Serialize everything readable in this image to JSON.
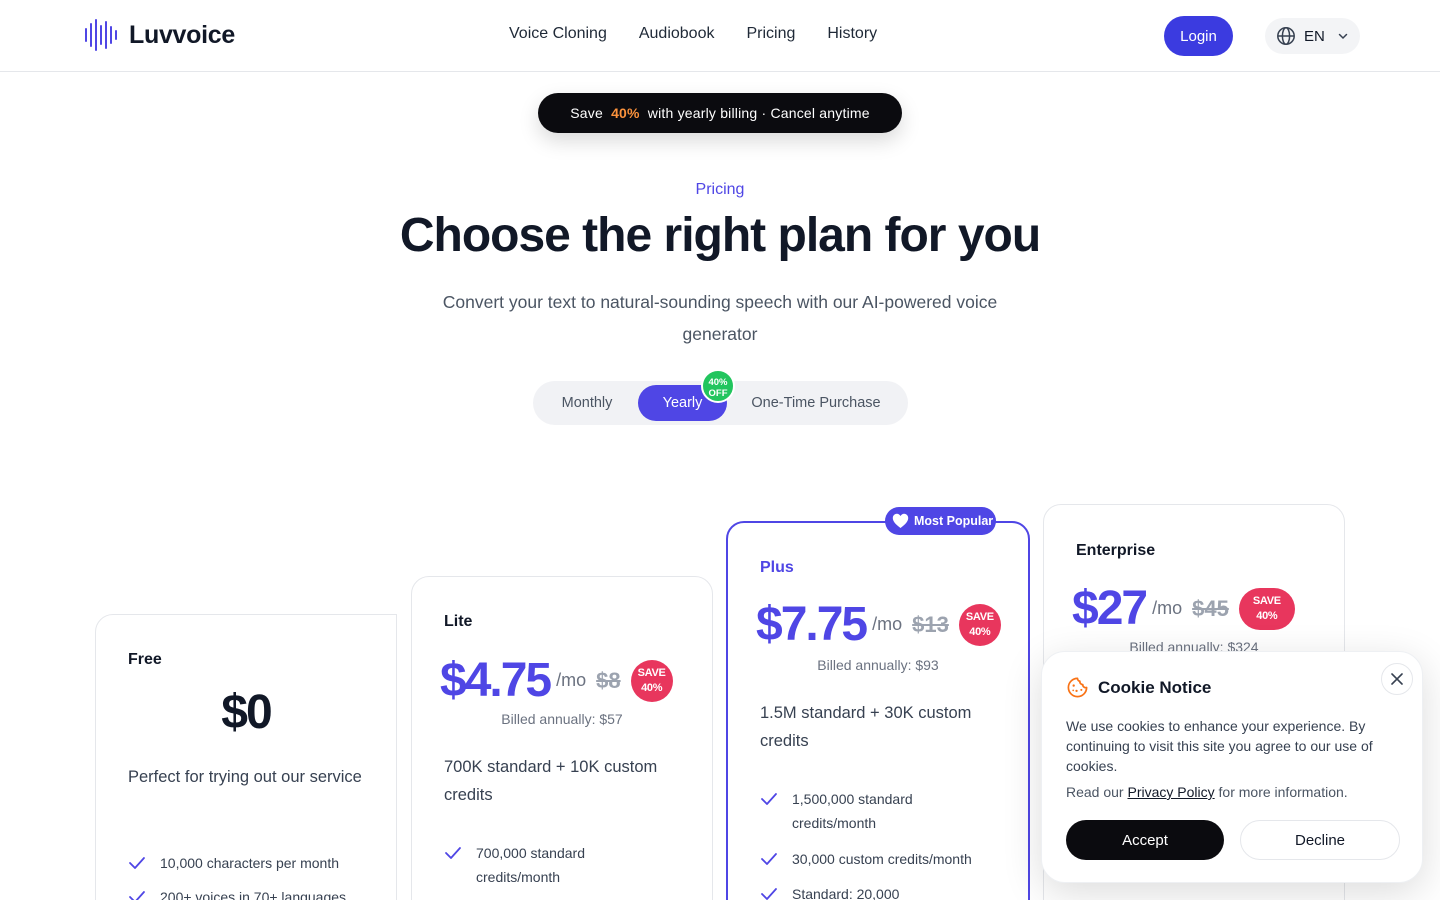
{
  "brand": {
    "name": "Luvvoice",
    "accent": "#4f46e5"
  },
  "nav": {
    "items": [
      "Voice Cloning",
      "Audiobook",
      "Pricing",
      "History"
    ]
  },
  "header": {
    "login_label": "Login",
    "language": "EN"
  },
  "promo": {
    "prefix": "Save ",
    "percent": "40%",
    "suffix": " with yearly billing · Cancel anytime"
  },
  "hero": {
    "eyebrow": "Pricing",
    "title": "Choose the right plan for you",
    "subtitle": "Convert your text to natural-sounding speech with our AI-powered voice generator"
  },
  "billing_toggle": {
    "options": [
      "Monthly",
      "Yearly",
      "One-Time Purchase"
    ],
    "selected": "Yearly",
    "badge_line1": "40%",
    "badge_line2": "OFF"
  },
  "plans": {
    "free": {
      "name": "Free",
      "price": "$0",
      "description": "Perfect for trying out our service",
      "features": [
        "10,000 characters per month",
        "200+ voices in 70+ languages"
      ]
    },
    "lite": {
      "name": "Lite",
      "price": "$4.75",
      "per": "/mo",
      "old_price": "$8",
      "save_line1": "SAVE",
      "save_line2": "40%",
      "billed": "Billed annually: $57",
      "description": "700K standard + 10K custom credits",
      "features": [
        "700,000 standard credits/month"
      ]
    },
    "plus": {
      "badge": "Most Popular",
      "name": "Plus",
      "price": "$7.75",
      "per": "/mo",
      "old_price": "$13",
      "save_line1": "SAVE",
      "save_line2": "40%",
      "billed": "Billed annually: $93",
      "description": "1.5M standard + 30K custom credits",
      "features": [
        "1,500,000 standard credits/month",
        "30,000 custom credits/month",
        "Standard: 20,000"
      ]
    },
    "enterprise": {
      "name": "Enterprise",
      "price": "$27",
      "per": "/mo",
      "old_price": "$45",
      "save_line1": "SAVE",
      "save_line2": "40%",
      "billed": "Billed annually: $324"
    }
  },
  "cookie": {
    "title": "Cookie Notice",
    "text": "We use cookies to enhance your experience. By continuing to visit this site you agree to our use of cookies.",
    "more_prefix": "Read our ",
    "policy_link": "Privacy Policy",
    "more_suffix": " for more information.",
    "accept_label": "Accept",
    "decline_label": "Decline"
  }
}
